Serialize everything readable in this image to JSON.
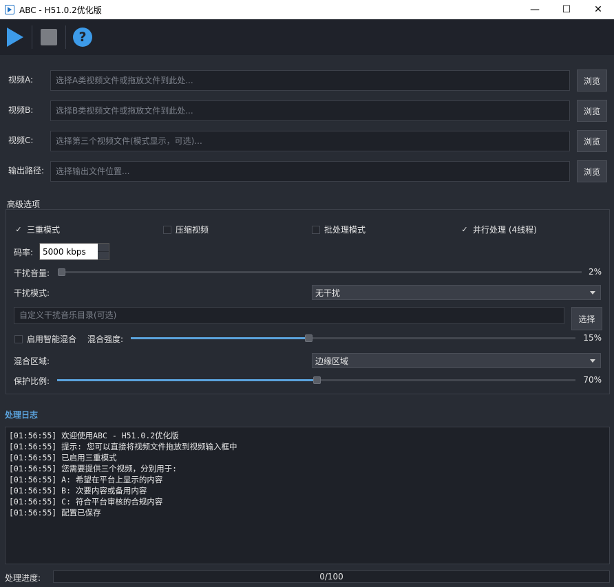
{
  "window": {
    "title": "ABC - H51.0.2优化版",
    "minimize": "—",
    "maximize": "☐",
    "close": "✕"
  },
  "toolbar": {
    "play_icon": "play-icon",
    "stop_icon": "stop-icon",
    "help_icon": "help-icon",
    "accent": "#3d9be9"
  },
  "inputs": [
    {
      "label": "视频A:",
      "placeholder": "选择A类视频文件或拖放文件到此处...",
      "button": "浏览"
    },
    {
      "label": "视频B:",
      "placeholder": "选择B类视频文件或拖放文件到此处...",
      "button": "浏览"
    },
    {
      "label": "视频C:",
      "placeholder": "选择第三个视频文件(模式显示，可选)...",
      "button": "浏览"
    },
    {
      "label": "输出路径:",
      "placeholder": "选择输出文件位置...",
      "button": "浏览"
    }
  ],
  "advanced": {
    "title": "高级选项",
    "checks": [
      {
        "label": "三重模式",
        "checked": true
      },
      {
        "label": "压缩视频",
        "checked": false
      },
      {
        "label": "批处理模式",
        "checked": false
      },
      {
        "label": "并行处理 (4线程)",
        "checked": true
      }
    ],
    "check_mark": "✓",
    "bitrate_label": "码率:",
    "bitrate_value": "5000 kbps",
    "volume_label": "干扰音量:",
    "volume_value": "2%",
    "volume_level": 0,
    "mode_label": "干扰模式:",
    "mode_value": "无干扰",
    "music_placeholder": "自定义干扰音乐目录(可选)",
    "select_button": "选择",
    "smart_mix_label": "启用智能混合",
    "smart_mix_checked": false,
    "mix_strength_label": "混合强度:",
    "mix_strength_value": "15%",
    "mix_strength_level": 0.15,
    "mix_region_label": "混合区域:",
    "mix_region_value": "边缘区域",
    "protect_label": "保护比例:",
    "protect_value": "70%",
    "protect_level": 0.7
  },
  "log": {
    "title": "处理日志",
    "lines": [
      "[01:56:55] 欢迎使用ABC - H51.0.2优化版",
      "[01:56:55] 提示: 您可以直接将视频文件拖放到视频输入框中",
      "[01:56:55] 已启用三重模式",
      "[01:56:55] 您需要提供三个视频，分别用于:",
      "[01:56:55] A: 希望在平台上显示的内容",
      "[01:56:55] B: 次要内容或备用内容",
      "[01:56:55] C: 符合平台审核的合规内容",
      "[01:56:55] 配置已保存"
    ]
  },
  "progress": {
    "label": "处理进度:",
    "text": "0/100",
    "value": 0
  }
}
